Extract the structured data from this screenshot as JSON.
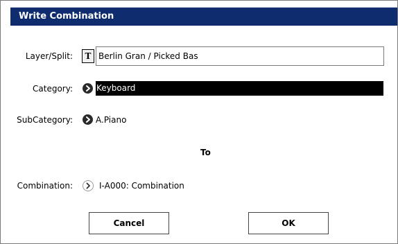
{
  "dialog": {
    "title": "Write Combination",
    "layer_split": {
      "label": "Layer/Split:",
      "text_button": "T",
      "value": "Berlin Gran / Picked Bas"
    },
    "category": {
      "label": "Category:",
      "value": "Keyboard"
    },
    "subcategory": {
      "label": "SubCategory:",
      "value": "A.Piano"
    },
    "to_label": "To",
    "combination": {
      "label": "Combination:",
      "value": "I-A000: Combination"
    },
    "buttons": {
      "cancel": "Cancel",
      "ok": "OK"
    }
  },
  "colors": {
    "titlebar": "#0f2d6e",
    "selected_field": "#000000"
  },
  "icons": {
    "text_edit": "text-edit-icon",
    "popup_arrow": "chevron-right-icon"
  }
}
